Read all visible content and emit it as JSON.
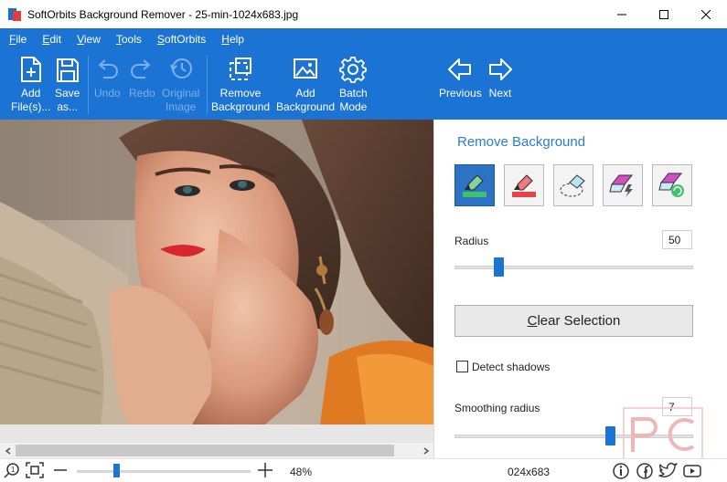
{
  "window": {
    "title": "SoftOrbits Background Remover - 25-min-1024x683.jpg"
  },
  "menu": [
    "File",
    "Edit",
    "View",
    "Tools",
    "SoftOrbits",
    "Help"
  ],
  "toolbar": {
    "add_files": [
      "Add",
      "File(s)..."
    ],
    "save_as": [
      "Save",
      "as..."
    ],
    "undo": "Undo",
    "redo": "Redo",
    "original_image": [
      "Original",
      "Image"
    ],
    "remove_background": [
      "Remove",
      "Background"
    ],
    "add_background": [
      "Add",
      "Background"
    ],
    "batch_mode": [
      "Batch",
      "Mode"
    ],
    "previous": "Previous",
    "next": "Next"
  },
  "panel": {
    "title": "Remove Background",
    "tools": [
      "keep-marker-icon",
      "remove-marker-icon",
      "eraser-selection-icon",
      "auto-eraser-icon",
      "restore-eraser-icon"
    ],
    "radius_label": "Radius",
    "radius_value": "50",
    "radius_level": 0.17,
    "clear_selection": "Clear Selection",
    "detect_shadows_label": "Detect shadows",
    "detect_shadows_checked": false,
    "smoothing_label": "Smoothing radius",
    "smoothing_value": "7",
    "smoothing_level": 0.66
  },
  "statusbar": {
    "zoom_percent": "48%",
    "zoom_level": 0.22,
    "dimensions": "024x683",
    "social_icons": [
      "info-icon",
      "facebook-icon",
      "twitter-icon",
      "youtube-icon"
    ]
  },
  "colors": {
    "accent": "#1b73d3",
    "panel_title": "#2a7ad6",
    "active_tool": "#2c73c4"
  }
}
